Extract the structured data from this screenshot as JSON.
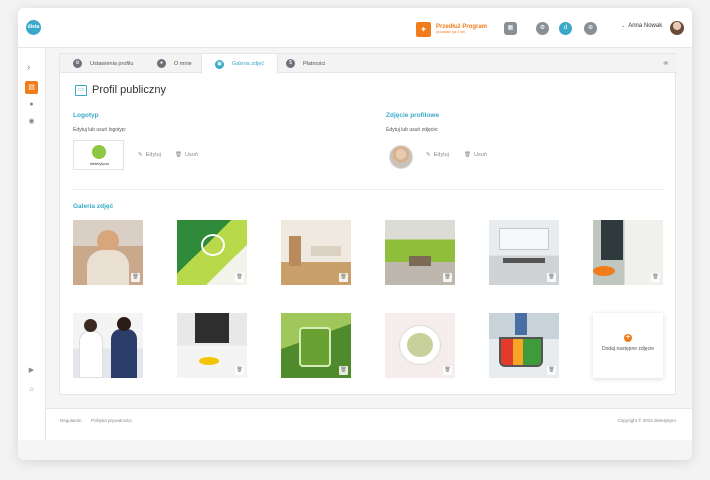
{
  "brand": {
    "logo_text": "dieta",
    "accent": "#3aa9c8",
    "orange": "#f07c1b"
  },
  "topbar": {
    "promo_title": "Przedłuż Program",
    "promo_sub": "pozostało już 4 dni",
    "user_name": "Anna Nowak",
    "icons": [
      "calendar-icon",
      "settings-icon",
      "app-icon",
      "cart-icon"
    ]
  },
  "sidebar": {
    "items": [
      "dashboard-icon",
      "user-icon",
      "location-icon",
      "video-icon",
      "building-icon"
    ]
  },
  "tabs": [
    {
      "label": "Ustawienia profilu",
      "icon": "gear-icon"
    },
    {
      "label": "O mnie",
      "icon": "person-icon"
    },
    {
      "label": "Galeria zdjęć",
      "icon": "image-icon",
      "active": true
    },
    {
      "label": "Płatności",
      "icon": "payment-icon"
    }
  ],
  "page": {
    "title": "Profil publiczny",
    "logo_section": {
      "title": "Logotyp",
      "desc": "Edytuj lub usuń logotyp:",
      "logo_word": "dietetykpro"
    },
    "photo_section": {
      "title": "Zdjęcie profilowe",
      "desc": "Edytuj lub usuń zdjęcie:"
    },
    "edit_label": "Edytuj",
    "remove_label": "Usuń",
    "gallery_title": "Galeria zdjęć",
    "add_label": "Dodaj następne zdjęcie"
  },
  "footer": {
    "links": [
      "Regulamin",
      "Polityka prywatności"
    ],
    "copyright": "Copyright © 2018 dietetykpro"
  }
}
